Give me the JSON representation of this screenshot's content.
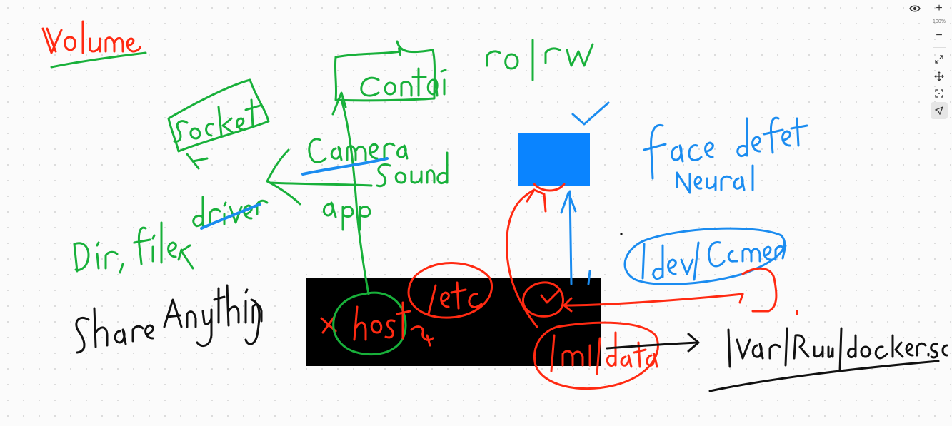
{
  "zoom": {
    "level": "100%"
  },
  "colors": {
    "red": "#ff2a12",
    "green": "#18b03a",
    "blue": "#1b8cf0",
    "black": "#111111",
    "rect_blue": "#0a84ff",
    "rect_black": "#000000"
  },
  "toolbar": {
    "icons": [
      "eye-icon",
      "zoom-in-icon",
      "zoom-out-icon",
      "fit-screen-icon",
      "pan-icon",
      "focus-icon",
      "pointer-icon"
    ]
  }
}
